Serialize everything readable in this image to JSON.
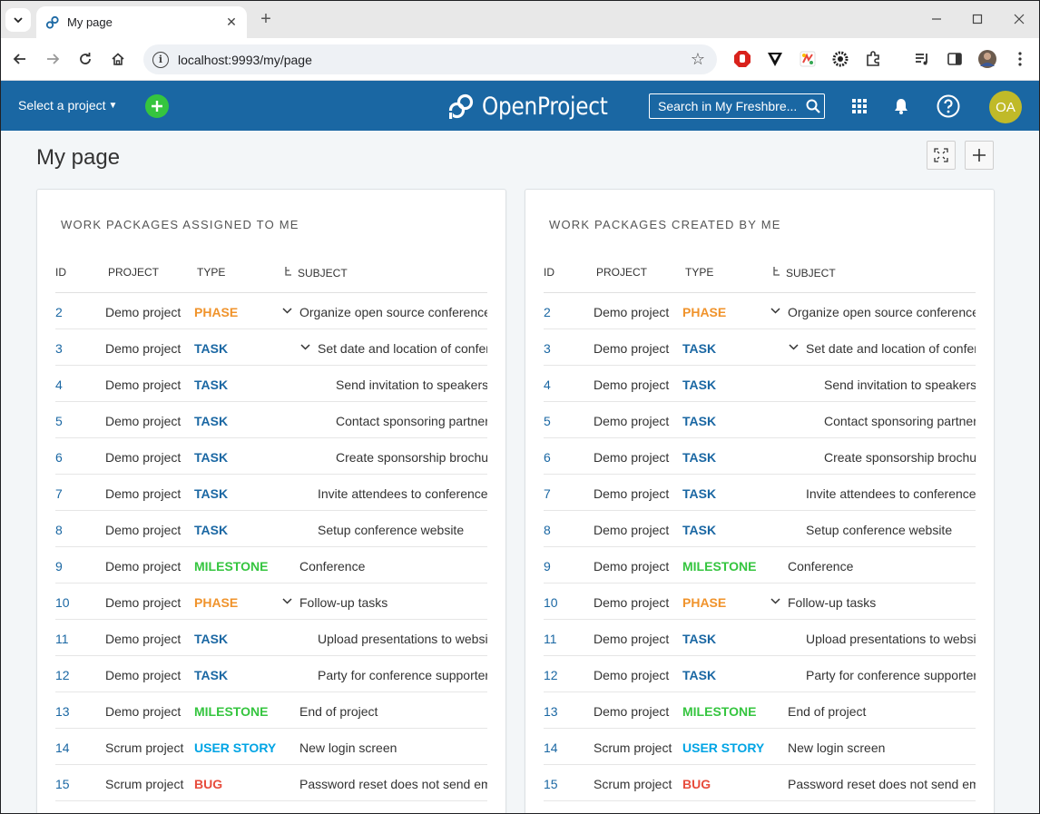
{
  "browser": {
    "tab_title": "My page",
    "url": "localhost:9993/my/page"
  },
  "header": {
    "project_select": "Select a project",
    "logo_text": "OpenProject",
    "search_text": "Search in My Freshbre...",
    "avatar_initials": "OA"
  },
  "page": {
    "title": "My page"
  },
  "columns": {
    "id": "ID",
    "project": "PROJECT",
    "type": "TYPE",
    "subject": "SUBJECT"
  },
  "type_colors": {
    "PHASE": "#f0932b",
    "TASK": "#1a67a3",
    "MILESTONE": "#35c53f",
    "USER STORY": "#00a4e4",
    "BUG": "#e74c3c"
  },
  "widgets": [
    {
      "title": "WORK PACKAGES ASSIGNED TO ME",
      "rows": [
        {
          "id": "2",
          "project": "Demo project",
          "type": "PHASE",
          "subject": "Organize open source conference",
          "level": 0,
          "expandable": true
        },
        {
          "id": "3",
          "project": "Demo project",
          "type": "TASK",
          "subject": "Set date and location of conference",
          "level": 1,
          "expandable": true
        },
        {
          "id": "4",
          "project": "Demo project",
          "type": "TASK",
          "subject": "Send invitation to speakers",
          "level": 2,
          "expandable": false
        },
        {
          "id": "5",
          "project": "Demo project",
          "type": "TASK",
          "subject": "Contact sponsoring partners",
          "level": 2,
          "expandable": false
        },
        {
          "id": "6",
          "project": "Demo project",
          "type": "TASK",
          "subject": "Create sponsorship brochure",
          "level": 2,
          "expandable": false
        },
        {
          "id": "7",
          "project": "Demo project",
          "type": "TASK",
          "subject": "Invite attendees to conference",
          "level": 1,
          "expandable": false
        },
        {
          "id": "8",
          "project": "Demo project",
          "type": "TASK",
          "subject": "Setup conference website",
          "level": 1,
          "expandable": false
        },
        {
          "id": "9",
          "project": "Demo project",
          "type": "MILESTONE",
          "subject": "Conference",
          "level": 0,
          "expandable": false
        },
        {
          "id": "10",
          "project": "Demo project",
          "type": "PHASE",
          "subject": "Follow-up tasks",
          "level": 0,
          "expandable": true
        },
        {
          "id": "11",
          "project": "Demo project",
          "type": "TASK",
          "subject": "Upload presentations to website",
          "level": 1,
          "expandable": false
        },
        {
          "id": "12",
          "project": "Demo project",
          "type": "TASK",
          "subject": "Party for conference supporters",
          "level": 1,
          "expandable": false
        },
        {
          "id": "13",
          "project": "Demo project",
          "type": "MILESTONE",
          "subject": "End of project",
          "level": 0,
          "expandable": false
        },
        {
          "id": "14",
          "project": "Scrum project",
          "type": "USER STORY",
          "subject": "New login screen",
          "level": 0,
          "expandable": false
        },
        {
          "id": "15",
          "project": "Scrum project",
          "type": "BUG",
          "subject": "Password reset does not send email",
          "level": 0,
          "expandable": false
        }
      ]
    },
    {
      "title": "WORK PACKAGES CREATED BY ME",
      "rows": [
        {
          "id": "2",
          "project": "Demo project",
          "type": "PHASE",
          "subject": "Organize open source conference",
          "level": 0,
          "expandable": true
        },
        {
          "id": "3",
          "project": "Demo project",
          "type": "TASK",
          "subject": "Set date and location of conference",
          "level": 1,
          "expandable": true
        },
        {
          "id": "4",
          "project": "Demo project",
          "type": "TASK",
          "subject": "Send invitation to speakers",
          "level": 2,
          "expandable": false
        },
        {
          "id": "5",
          "project": "Demo project",
          "type": "TASK",
          "subject": "Contact sponsoring partners",
          "level": 2,
          "expandable": false
        },
        {
          "id": "6",
          "project": "Demo project",
          "type": "TASK",
          "subject": "Create sponsorship brochure",
          "level": 2,
          "expandable": false
        },
        {
          "id": "7",
          "project": "Demo project",
          "type": "TASK",
          "subject": "Invite attendees to conference",
          "level": 1,
          "expandable": false
        },
        {
          "id": "8",
          "project": "Demo project",
          "type": "TASK",
          "subject": "Setup conference website",
          "level": 1,
          "expandable": false
        },
        {
          "id": "9",
          "project": "Demo project",
          "type": "MILESTONE",
          "subject": "Conference",
          "level": 0,
          "expandable": false
        },
        {
          "id": "10",
          "project": "Demo project",
          "type": "PHASE",
          "subject": "Follow-up tasks",
          "level": 0,
          "expandable": true
        },
        {
          "id": "11",
          "project": "Demo project",
          "type": "TASK",
          "subject": "Upload presentations to website",
          "level": 1,
          "expandable": false
        },
        {
          "id": "12",
          "project": "Demo project",
          "type": "TASK",
          "subject": "Party for conference supporters",
          "level": 1,
          "expandable": false
        },
        {
          "id": "13",
          "project": "Demo project",
          "type": "MILESTONE",
          "subject": "End of project",
          "level": 0,
          "expandable": false
        },
        {
          "id": "14",
          "project": "Scrum project",
          "type": "USER STORY",
          "subject": "New login screen",
          "level": 0,
          "expandable": false
        },
        {
          "id": "15",
          "project": "Scrum project",
          "type": "BUG",
          "subject": "Password reset does not send email",
          "level": 0,
          "expandable": false
        }
      ]
    }
  ]
}
